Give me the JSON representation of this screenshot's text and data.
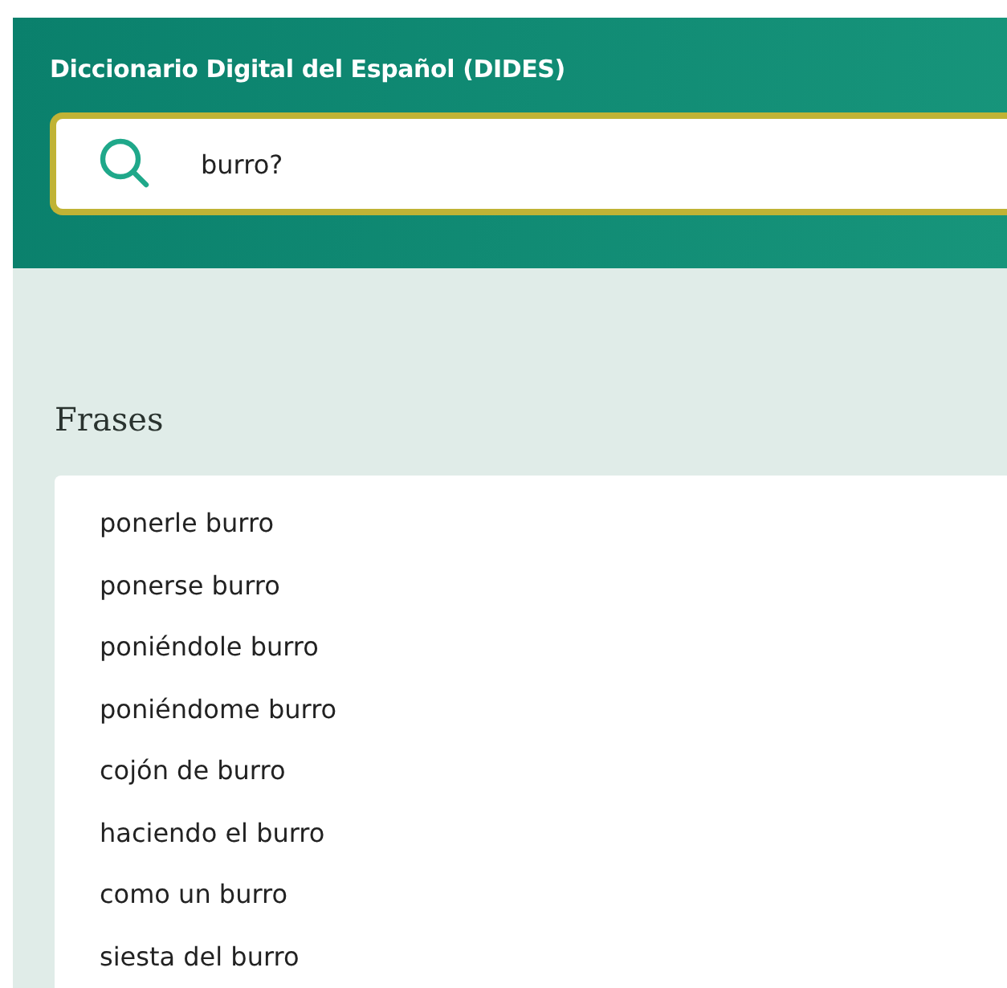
{
  "header": {
    "title": "Diccionario Digital del Español (DIDES)"
  },
  "search": {
    "value": "burro?"
  },
  "section": {
    "heading": "Frases",
    "items": [
      "ponerle burro",
      "ponerse burro",
      "poniéndole burro",
      "poniéndome burro",
      "cojón de burro",
      "haciendo el burro",
      "como un burro",
      "siesta del burro"
    ]
  }
}
